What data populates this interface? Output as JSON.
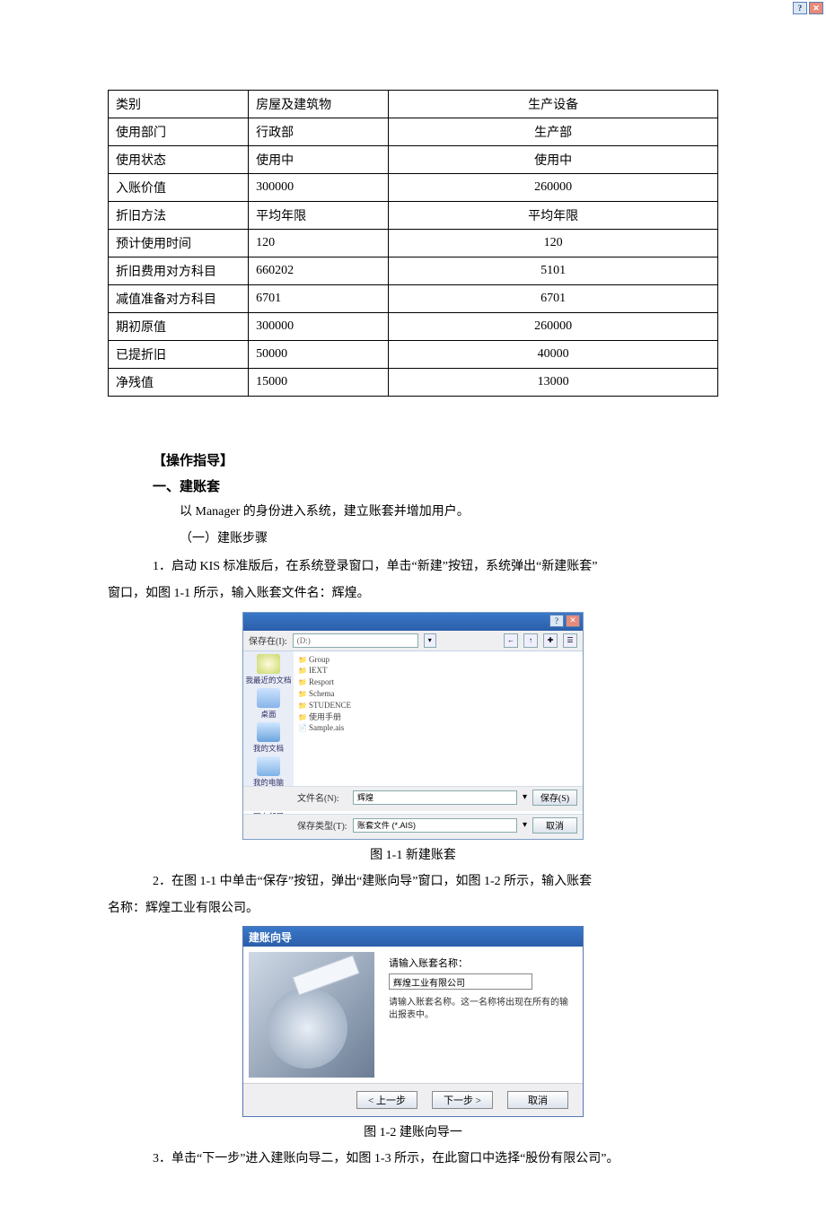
{
  "table": {
    "rows": [
      {
        "label": "类别",
        "c1": "房屋及建筑物",
        "c2": "生产设备"
      },
      {
        "label": "使用部门",
        "c1": "行政部",
        "c2": "生产部"
      },
      {
        "label": "使用状态",
        "c1": "使用中",
        "c2": "使用中"
      },
      {
        "label": "入账价值",
        "c1": "300000",
        "c2": "260000"
      },
      {
        "label": "折旧方法",
        "c1": "平均年限",
        "c2": "平均年限"
      },
      {
        "label": "预计使用时间",
        "c1": "120",
        "c2": "120"
      },
      {
        "label": "折旧费用对方科目",
        "c1": "660202",
        "c2": "5101"
      },
      {
        "label": "减值准备对方科目",
        "c1": "6701",
        "c2": "6701"
      },
      {
        "label": "期初原值",
        "c1": "300000",
        "c2": "260000"
      },
      {
        "label": "已提折旧",
        "c1": "50000",
        "c2": "40000"
      },
      {
        "label": "净残值",
        "c1": "15000",
        "c2": "13000"
      }
    ]
  },
  "text": {
    "guide_label": "【操作指导】",
    "heading1": "一、建账套",
    "intro": "以 Manager 的身份进入系统，建立账套并增加用户。",
    "sub1": "（一）建账步骤",
    "step1a": "1．启动 KIS 标准版后，在系统登录窗口，单击“新建”按钮，系统弹出“新建账套”",
    "step1b": "窗口，如图 1-1 所示，输入账套文件名：辉煌。",
    "caption1": "图 1-1 新建账套",
    "step2a": "2．在图 1-1 中单击“保存”按钮，弹出“建账向导”窗口，如图 1-2 所示，输入账套",
    "step2b": "名称：辉煌工业有限公司。",
    "caption2": "图 1-2 建账向导一",
    "step3": "3．单击“下一步”进入建账向导二，如图 1-3 所示，在此窗口中选择“股份有限公司”。"
  },
  "dialog1": {
    "save_in_label": "保存在(I):",
    "combo_text": "(D:)",
    "places": [
      "我最近的文档",
      "桌面",
      "我的文档",
      "我的电脑",
      "网上邻居"
    ],
    "files": [
      {
        "t": "folder",
        "n": "Group"
      },
      {
        "t": "folder",
        "n": "IEXT"
      },
      {
        "t": "folder",
        "n": "Resport"
      },
      {
        "t": "folder",
        "n": "Schema"
      },
      {
        "t": "folder",
        "n": "STUDENCE"
      },
      {
        "t": "folder",
        "n": "使用手册"
      },
      {
        "t": "file",
        "n": "Sample.ais"
      }
    ],
    "filename_label": "文件名(N):",
    "filename_value": "辉煌",
    "filetype_label": "保存类型(T):",
    "filetype_value": "账套文件 (*.AIS)",
    "save_btn": "保存(S)",
    "cancel_btn": "取消"
  },
  "dialog2": {
    "title": "建账向导",
    "prompt": "请输入账套名称：",
    "input_value": "辉煌工业有限公司",
    "desc": "请输入账套名称。这一名称将出现在所有的输出报表中。",
    "prev": "< 上一步",
    "next": "下一步 >",
    "cancel": "取消"
  }
}
